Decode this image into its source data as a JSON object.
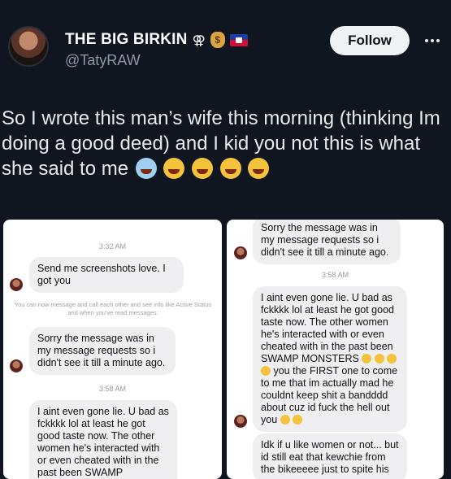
{
  "author": {
    "display_name": "THE BIG BIRKIN",
    "name_symbol": "⚢",
    "money_bag_label": "$",
    "handle": "@TatyRAW"
  },
  "actions": {
    "follow_label": "Follow"
  },
  "tweet": {
    "text": "So I wrote this man’s wife this morning (thinking Im doing a good deed) and I kid you not this is what she said to me"
  },
  "screenshots": {
    "left": {
      "timestamp_1": "3:32 AM",
      "message_1": "Send me screenshots love. I got you",
      "notice": "You can now message and call each other and see info like Active Status and when you've read messages.",
      "message_2": "Sorry the message was in my message requests so i didn't see it till a minute ago.",
      "timestamp_2": "3:58 AM",
      "message_3": "I aint even gone lie. U bad as fckkkk lol at least he got good taste now. The other women he's interacted with or even cheated with in the past been SWAMP MONSTERS"
    },
    "right": {
      "message_1": "Sorry the message was in my message requests so i didn't see it till a minute ago.",
      "timestamp_1": "3:58 AM",
      "message_2": "I aint even gone lie. U bad as fckkkk lol at least he got good taste now. The other women he's interacted with or even cheated with in the past been SWAMP MONSTERS",
      "message_2b": "you the FIRST one to come to me that im actually mad he couldnt keep shit a bandddd about cuz id fuck the hell out you",
      "message_3": "Idk if u like women or not... but id still eat that kewchie from the bikeeeee just to spite his"
    }
  },
  "colors": {
    "background": "#0f1620",
    "text": "#e7e9ea",
    "muted": "#8b98a5",
    "follow_bg": "#eff3f4",
    "bubble": "#efeff1"
  }
}
